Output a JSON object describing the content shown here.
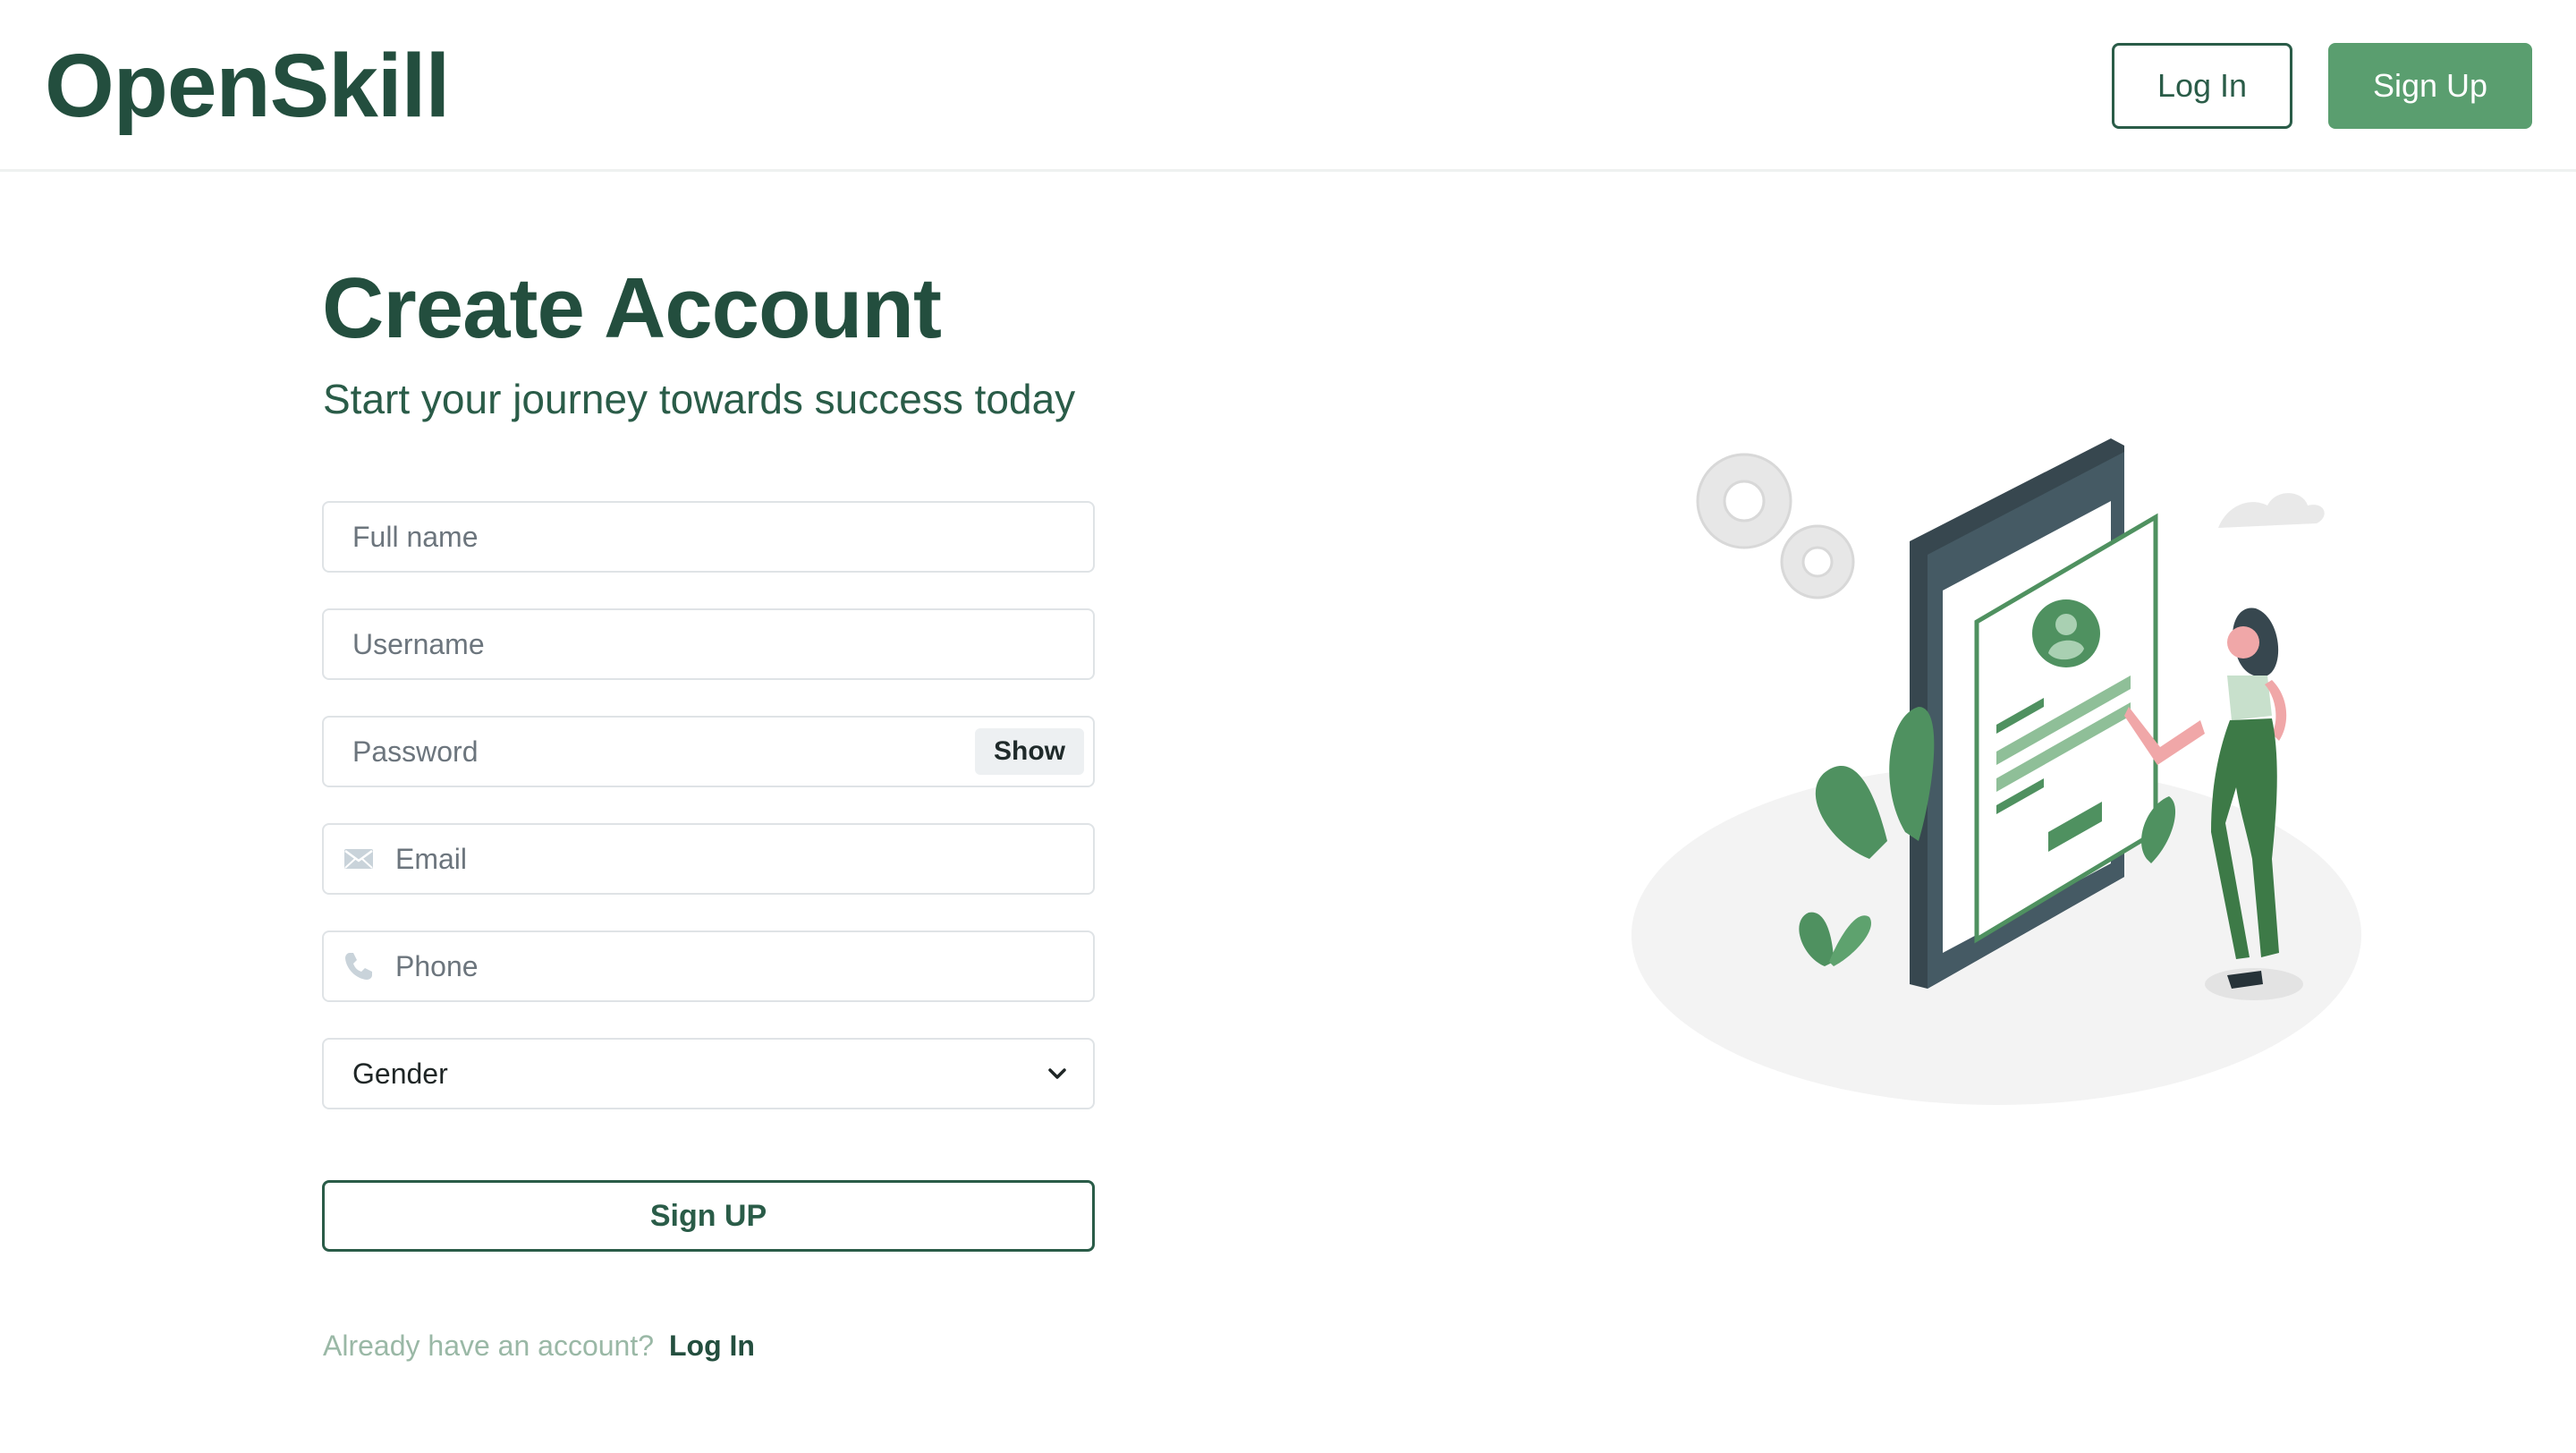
{
  "header": {
    "logo": "OpenSkill",
    "login_label": "Log In",
    "signup_label": "Sign Up"
  },
  "main": {
    "title": "Create Account",
    "subtitle": "Start your journey towards success today"
  },
  "form": {
    "full_name": {
      "placeholder": "Full name",
      "value": ""
    },
    "username": {
      "placeholder": "Username",
      "value": ""
    },
    "password": {
      "placeholder": "Password",
      "value": "",
      "show_label": "Show"
    },
    "email": {
      "placeholder": "Email",
      "value": "",
      "icon": "envelope-icon"
    },
    "phone": {
      "placeholder": "Phone",
      "value": "",
      "icon": "phone-icon"
    },
    "gender": {
      "selected": "Gender"
    },
    "submit_label": "Sign UP"
  },
  "footer": {
    "prompt": "Already have an account?",
    "login_link": "Log In"
  },
  "colors": {
    "primary": "#234e3e",
    "accent": "#5a9e6f",
    "muted_text": "#9ab8a6",
    "border": "#dfe3e6"
  }
}
